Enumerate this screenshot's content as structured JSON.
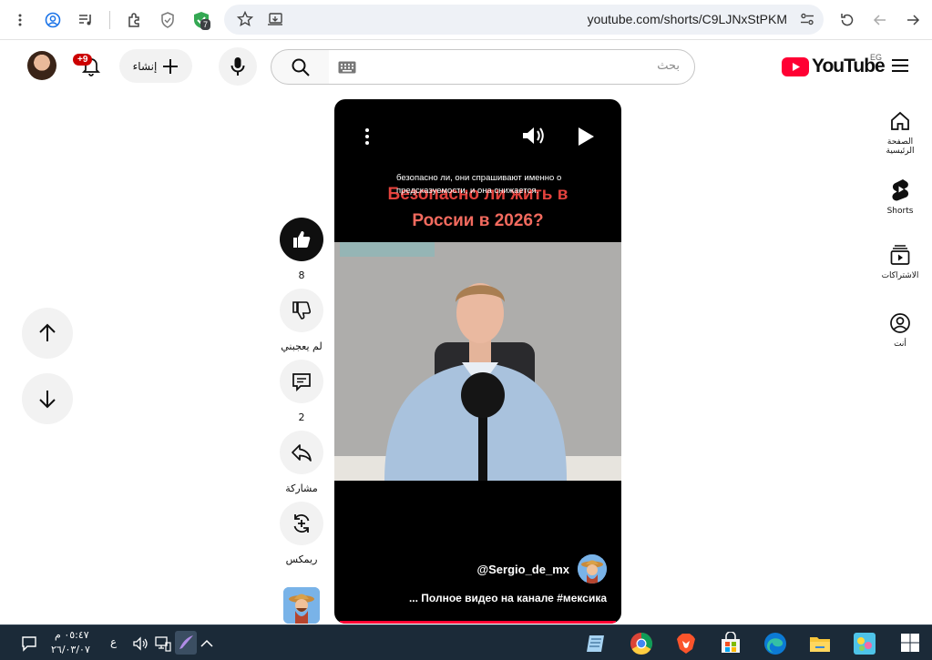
{
  "browser": {
    "url": "youtube.com/shorts/C9LJNxStPKM",
    "extension_badge": "7"
  },
  "header": {
    "logo_text": "YouTube",
    "region": "EG",
    "search_placeholder": "بحث",
    "create_label": "إنشاء",
    "notifications_badge": "+9"
  },
  "guide": {
    "items": [
      {
        "label": "الصفحة الرئيسية",
        "icon": "home-icon"
      },
      {
        "label": "Shorts",
        "icon": "shorts-icon"
      },
      {
        "label": "الاشتراكات",
        "icon": "subscriptions-icon"
      },
      {
        "label": "أنت",
        "icon": "you-icon"
      }
    ]
  },
  "short": {
    "caption_top": "безопасно ли, они спрашивают именно о предсказуемости, и она снижается.",
    "title_line1": "Безопасно ли жить в",
    "title_line2": "России в 2026?",
    "channel": "@Sergio_de_mx",
    "description": "... Полное видео на канале #мексика",
    "progress": 1.0
  },
  "actions": {
    "like_count": "8",
    "dislike_label": "لم يعجبني",
    "comment_count": "2",
    "share_label": "مشاركة",
    "remix_label": "ريمكس"
  },
  "taskbar": {
    "time": "٠٥:٤٧ م",
    "date": "٢٦/٠٣/٠٧",
    "language": "ع"
  },
  "colors": {
    "youtube_red": "#ff0033",
    "title_red": "#e3423d",
    "taskbar_bg": "#1b2a38"
  }
}
